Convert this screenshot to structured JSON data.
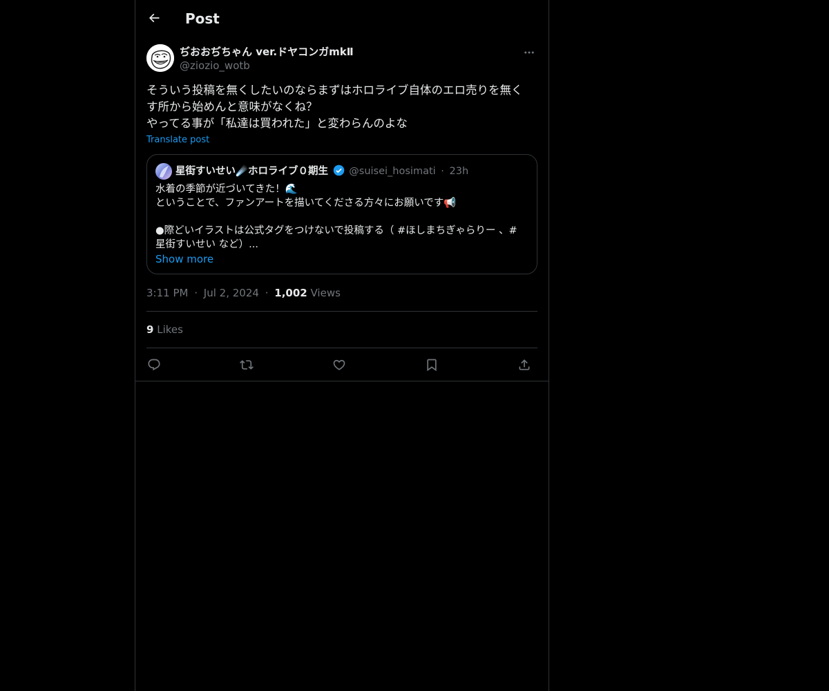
{
  "header": {
    "title": "Post",
    "back_icon": "arrow-left-icon"
  },
  "author": {
    "name": "ぢおおぢちゃん ver.ドヤコンガmkⅡ",
    "handle": "@ziozio_wotb",
    "avatar_icon": "troll-face-avatar"
  },
  "post": {
    "lines": [
      "そういう投稿を無くしたいのならまずはホロライブ自体のエロ売りを無く",
      "す所から始めんと意味がなくね？",
      "やってる事が「私達は買われた」と変わらんのよな"
    ],
    "translate_label": "Translate post"
  },
  "quote": {
    "name": "星街すいせい☄️ホロライブ０期生",
    "handle": "@suisei_hosimati",
    "dot": "·",
    "time": "23h",
    "lines": [
      "水着の季節が近づいてきた！🌊",
      "ということで、ファンアートを描いてくださる方々にお願いです📢",
      "",
      "●際どいイラストは公式タグをつけないで投稿する（ #ほしまちぎゃらりー 、#",
      "星街すいせい など）..."
    ],
    "show_more": "Show more"
  },
  "meta": {
    "time": "3:11 PM",
    "date": "Jul 2, 2024",
    "views_count": "1,002",
    "views_label": "Views",
    "sep": "·"
  },
  "stats": {
    "likes_count": "9",
    "likes_label": "Likes"
  },
  "actions": [
    "reply-icon",
    "repost-icon",
    "like-icon",
    "bookmark-icon",
    "share-icon"
  ],
  "colors": {
    "background": "#000000",
    "text": "#e7e9ea",
    "secondary": "#71767b",
    "accent": "#1d9bf0",
    "border": "#2f3336"
  }
}
